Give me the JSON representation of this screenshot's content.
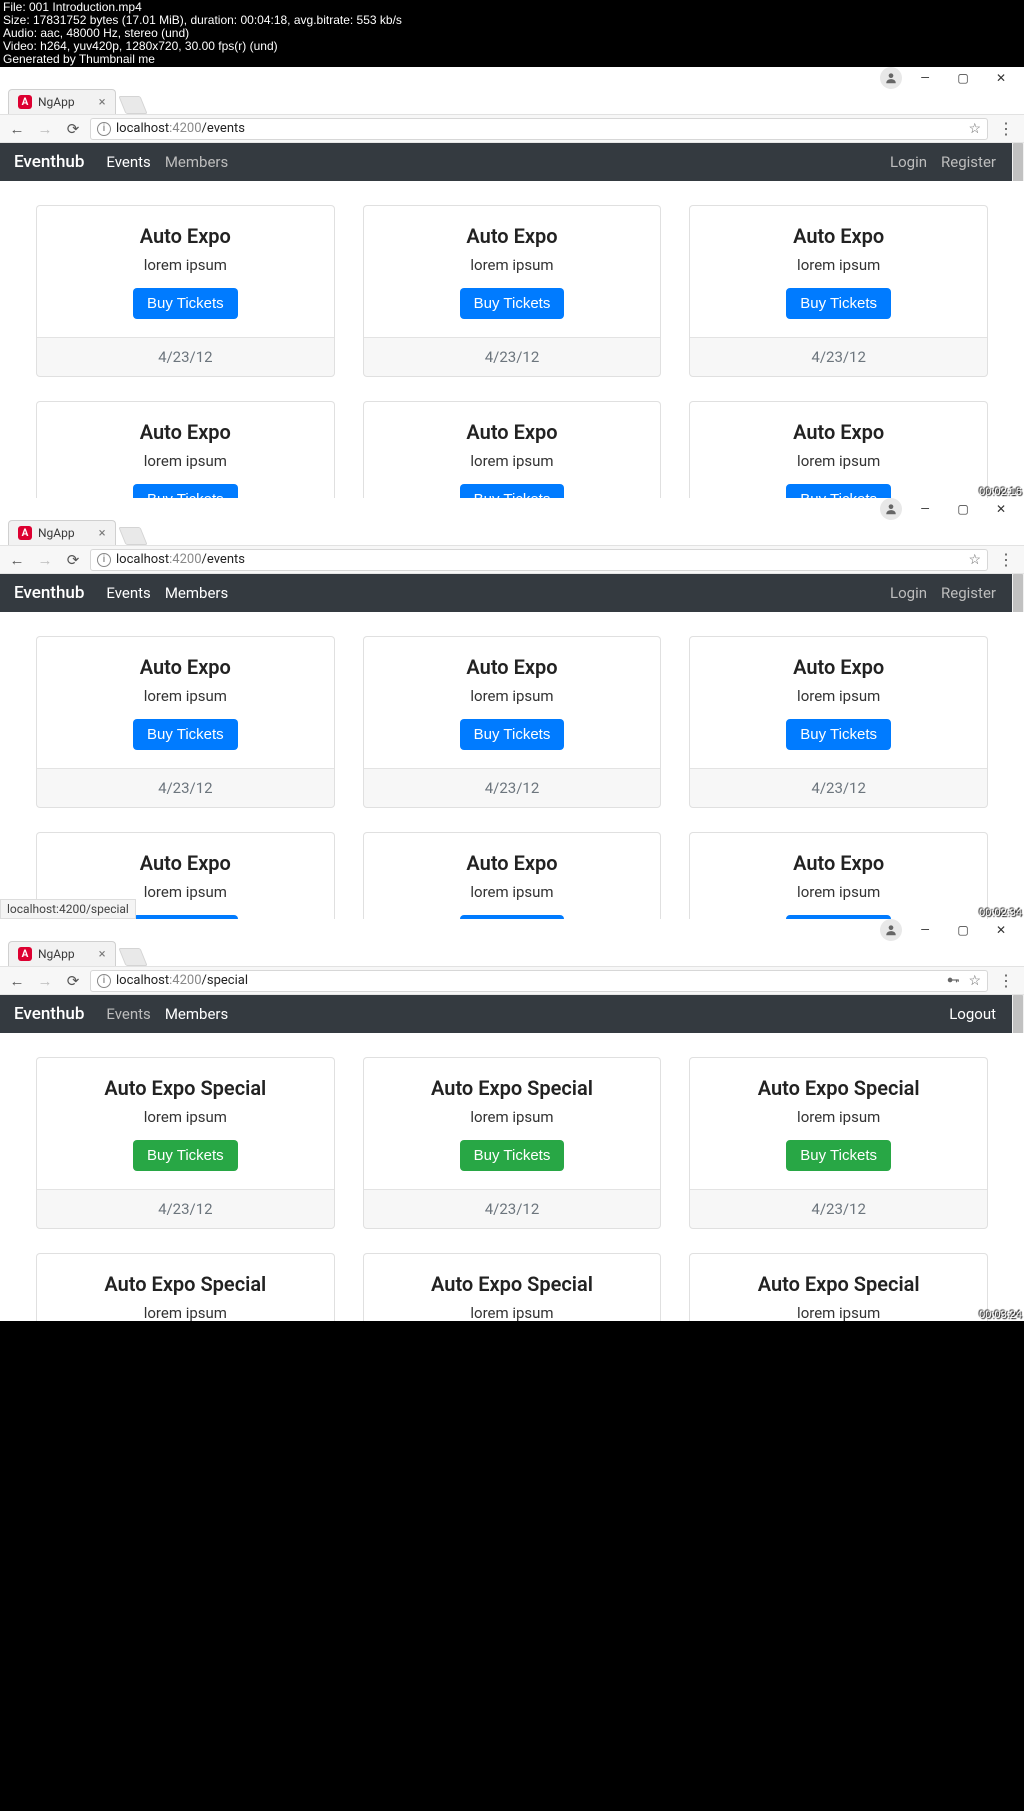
{
  "overlay": {
    "line1": "File: 001 Introduction.mp4",
    "line2": "Size: 17831752 bytes (17.01 MiB), duration: 00:04:18, avg.bitrate: 553 kb/s",
    "line3": "Audio: aac, 48000 Hz, stereo (und)",
    "line4": "Video: h264, yuv420p, 1280x720, 30.00 fps(r) (und)",
    "line5": "Generated by Thumbnail me"
  },
  "tab_title": "NgApp",
  "url_host": "localhost",
  "url_port": ":4200",
  "frames": {
    "f1": {
      "path": "/events",
      "nav_active": "Events",
      "right_links": [
        "Login",
        "Register"
      ],
      "card_title": "Auto Expo",
      "btn_style": "blue",
      "timestamp": "00:02:16"
    },
    "f2": {
      "path": "/events",
      "nav_active": "Members",
      "right_links": [
        "Login",
        "Register"
      ],
      "card_title": "Auto Expo",
      "btn_style": "blue",
      "status_hint": "localhost:4200/special",
      "timestamp": "00:02:34"
    },
    "f3": {
      "path": "/special",
      "nav_active": "Members",
      "right_links": [
        "Logout"
      ],
      "card_title": "Auto Expo Special",
      "btn_style": "green",
      "secure": true,
      "timestamp": "00:03:24"
    }
  },
  "brand": "Eventhub",
  "nav_items": [
    "Events",
    "Members"
  ],
  "card_sub": "lorem ipsum",
  "btn_label": "Buy Tickets",
  "card_date": "4/23/12"
}
